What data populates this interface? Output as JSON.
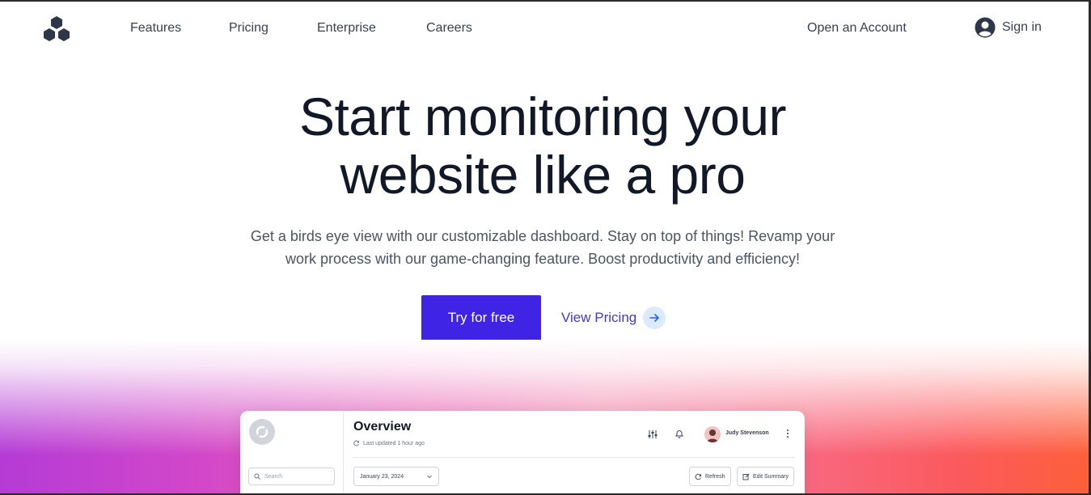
{
  "nav": {
    "logo_icon": "three-petal-logo-icon",
    "links": [
      "Features",
      "Pricing",
      "Enterprise",
      "Careers"
    ],
    "open_account": "Open an Account",
    "sign_in": "Sign in",
    "user_icon": "user-circle-icon"
  },
  "hero": {
    "title_line1": "Start monitoring your",
    "title_line2": "website like a pro",
    "subtitle_line1": "Get a birds eye view with our customizable dashboard. Stay on top of things! Revamp your",
    "subtitle_line2": "work process with our game-changing feature. Boost productivity and efficiency!",
    "cta_primary": "Try for free",
    "cta_secondary": "View Pricing",
    "cta_secondary_icon": "arrow-right-icon"
  },
  "dashboard": {
    "title": "Overview",
    "last_updated": "Last updated 1 hour ago",
    "search_placeholder": "Search",
    "user_name": "Judy Stevenson",
    "date": "January 23, 2024",
    "refresh_label": "Refresh",
    "edit_summary_label": "Edit Summary"
  },
  "colors": {
    "primary": "#4024e6",
    "link": "#4338ca",
    "heading": "#111827",
    "body_text": "#4b5563"
  }
}
